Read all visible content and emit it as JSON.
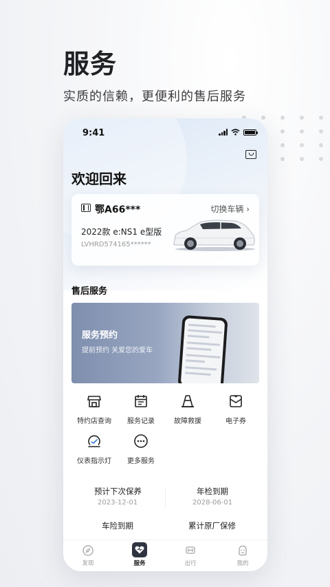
{
  "promo": {
    "headline": "服务",
    "subline": "实质的信赖，更便利的售后服务"
  },
  "status_bar": {
    "time": "9:41"
  },
  "home": {
    "welcome": "欢迎回来",
    "vehicle": {
      "plate": "鄂A66***",
      "switch_label": "切换车辆",
      "model": "2022款 e:NS1 e型版",
      "vin": "LVHRD574165******"
    },
    "aftersales_title": "售后服务",
    "banner": {
      "title": "服务预约",
      "subtitle": "提前预约 关爱您的爱车"
    },
    "services": [
      {
        "label": "特约店查询",
        "icon": "store-icon"
      },
      {
        "label": "服务记录",
        "icon": "calendar-icon"
      },
      {
        "label": "故障救援",
        "icon": "cone-icon"
      },
      {
        "label": "电子券",
        "icon": "coupon-icon"
      },
      {
        "label": "仪表指示灯",
        "icon": "gauge-icon"
      },
      {
        "label": "更多服务",
        "icon": "more-icon"
      }
    ],
    "info": [
      {
        "label": "预计下次保养",
        "value": "2023-12-01"
      },
      {
        "label": "年检到期",
        "value": "2028-06-01"
      },
      {
        "label": "车险到期",
        "value": ""
      },
      {
        "label": "累计原厂保修",
        "value": ""
      }
    ]
  },
  "tabbar": [
    {
      "label": "发现",
      "icon": "compass-icon"
    },
    {
      "label": "服务",
      "icon": "service-heart-icon",
      "active": true
    },
    {
      "label": "出行",
      "icon": "car-icon"
    },
    {
      "label": "我的",
      "icon": "profile-icon"
    }
  ],
  "colors": {
    "accent": "#2f3440",
    "banner": "#8d9bb8",
    "muted": "#9a9a9a"
  }
}
